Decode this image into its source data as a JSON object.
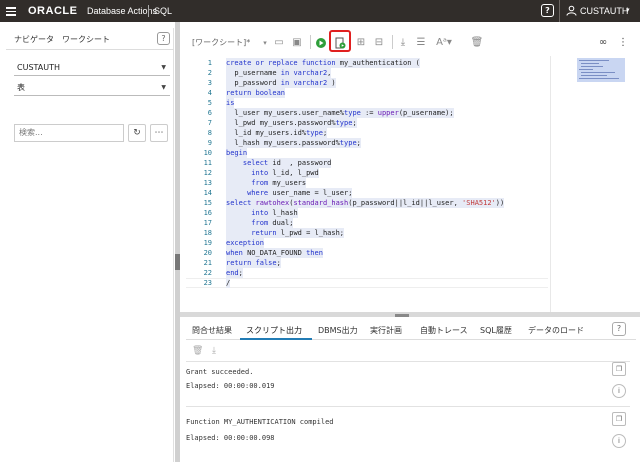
{
  "header": {
    "logo": "ORACLE",
    "product": "Database Actions",
    "module": "SQL",
    "help_label": "?",
    "user": "CUSTAUTH"
  },
  "left_panel": {
    "tabs": [
      "ナビゲータ",
      "ワークシート"
    ],
    "help_label": "?",
    "schema_select": "CUSTAUTH",
    "type_select": "表",
    "search_placeholder": "検索..."
  },
  "editor": {
    "worksheet_name": "[ワークシート]*",
    "line_numbers": [
      "1",
      "2",
      "3",
      "4",
      "5",
      "6",
      "7",
      "8",
      "9",
      "10",
      "11",
      "12",
      "13",
      "14",
      "15",
      "16",
      "17",
      "18",
      "19",
      "20",
      "21",
      "22",
      "23"
    ]
  },
  "bottom_panel": {
    "tabs": [
      "問合せ結果",
      "スクリプト出力",
      "DBMS出力",
      "実行計画",
      "自動トレース",
      "SQL履歴",
      "データのロード"
    ],
    "active_tab": "スクリプト出力",
    "help_label": "?",
    "output": [
      {
        "message": "Grant succeeded.",
        "elapsed": "Elapsed: 00:00:00.019"
      },
      {
        "message": "Function MY_AUTHENTICATION compiled",
        "elapsed": "Elapsed: 00:00:00.098"
      }
    ]
  },
  "colors": {
    "header_bg": "#312d2a",
    "accent": "#227cb5",
    "highlight_box": "#e02020",
    "selection": "#e7ebf6"
  },
  "icons": {
    "run": "play-icon",
    "run_script": "run-script-icon",
    "explain": "explain-plan-icon",
    "autotrace": "autotrace-icon",
    "download": "download-icon",
    "format": "format-icon",
    "case": "text-case-icon",
    "clear": "trash-icon",
    "find": "binoculars-icon",
    "menu": "kebab-icon"
  }
}
